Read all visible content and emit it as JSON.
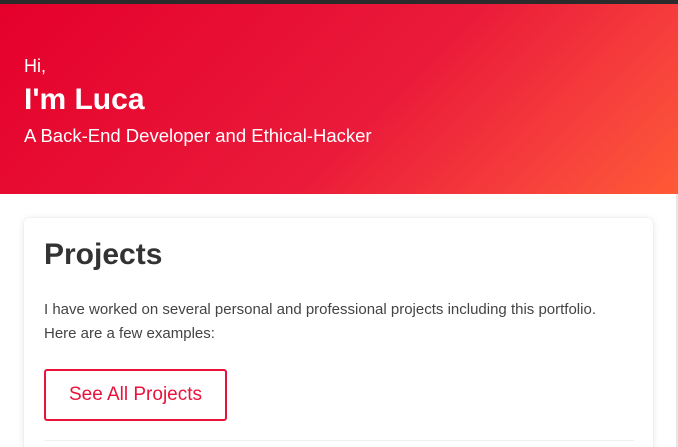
{
  "hero": {
    "greeting": "Hi,",
    "name": "I'm Luca",
    "tagline": "A Back-End Developer and Ethical-Hacker"
  },
  "projects": {
    "title": "Projects",
    "description": "I have worked on several personal and professional projects including this portfolio. Here are a few examples:",
    "button_label": "See All Projects"
  },
  "colors": {
    "accent": "#e8123a",
    "hero_gradient_start": "#e5002b",
    "hero_gradient_end": "#ff5a36",
    "heading": "#333333",
    "body_text": "#444444"
  }
}
